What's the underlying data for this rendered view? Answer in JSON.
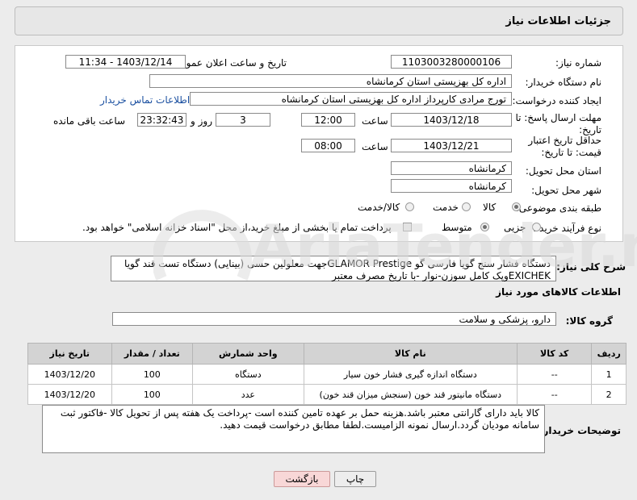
{
  "header": {
    "title": "جزئیات اطلاعات نیاز"
  },
  "form": {
    "need_number": {
      "label": "شماره نیاز:",
      "value": "1103003280000106"
    },
    "announce_datetime": {
      "label": "تاریخ و ساعت اعلان عمومی:",
      "value": "1403/12/14 - 11:34"
    },
    "buyer_org": {
      "label": "نام دستگاه خریدار:",
      "value": "اداره کل بهزیستی استان کرمانشاه"
    },
    "requester": {
      "label": "ایجاد کننده درخواست:",
      "value": "تورج مرادی کارپرداز  اداره کل بهزیستی استان کرمانشاه",
      "contact_link": "اطلاعات تماس خریدار"
    },
    "reply_deadline": {
      "label": "مهلت ارسال پاسخ: تا تاریخ:",
      "date": "1403/12/18",
      "time_label": "ساعت",
      "time": "12:00",
      "days": "3",
      "days_label": "روز و",
      "remaining": "23:32:43",
      "remaining_label": "ساعت باقی مانده"
    },
    "price_validity": {
      "label": "حداقل تاریخ اعتبار قیمت: تا تاریخ:",
      "date": "1403/12/21",
      "time_label": "ساعت",
      "time": "08:00"
    },
    "delivery_province": {
      "label": "استان محل تحویل:",
      "value": "کرمانشاه"
    },
    "delivery_city": {
      "label": "شهر محل تحویل:",
      "value": "کرمانشاه"
    },
    "category": {
      "label": "طبقه بندی موضوعی:",
      "options": [
        "کالا",
        "خدمت",
        "کالا/خدمت"
      ],
      "selected": "کالا"
    },
    "purchase_type": {
      "label": "نوع فرآیند خرید :",
      "options": [
        "جزیی",
        "متوسط"
      ],
      "selected": "متوسط",
      "payment_note": "پرداخت تمام یا بخشی از مبلغ خرید،از محل \"اسناد خزانه اسلامی\" خواهد بود."
    }
  },
  "description": {
    "label": "شرح کلی نیاز:",
    "line1": "دستگاه فشار سنج گویا  فارسی گو GLAMOR Prestigeجهت معلولین حسی (بینایی)  دستگاه تست قند گویا",
    "line2": "EXICHEKوپک کامل سوزن-نوار -با تاریخ مصرف  معتبر"
  },
  "goods_info": {
    "title": "اطلاعات کالاهای مورد نیاز",
    "group_label": "گروه کالا:",
    "group_value": "دارو، پزشکی و سلامت"
  },
  "table": {
    "headers": [
      "ردیف",
      "کد کالا",
      "نام کالا",
      "واحد شمارش",
      "تعداد / مقدار",
      "تاریخ نیاز"
    ],
    "rows": [
      [
        "1",
        "--",
        "دستگاه اندازه گیری فشار خون سیار",
        "دستگاه",
        "100",
        "1403/12/20"
      ],
      [
        "2",
        "--",
        "دستگاه مانیتور قند خون (سنجش میزان قند خون)",
        "عدد",
        "100",
        "1403/12/20"
      ]
    ]
  },
  "buyer_notes": {
    "label": "توضیحات خریدار:",
    "line1": "کالا باید دارای  گارانتی معتبر باشد.هزینه حمل بر عهده تامین کننده است -پرداخت یک هفته پس از تحویل کالا -فاکتور ثبت",
    "line2": "سامانه مودیان گردد.ارسال نمونه الزامیست.لطفا مطابق درخواست قیمت دهید."
  },
  "buttons": {
    "print": "چاپ",
    "back": "بازگشت"
  },
  "watermark": {
    "text": "AriaTender.neT"
  }
}
